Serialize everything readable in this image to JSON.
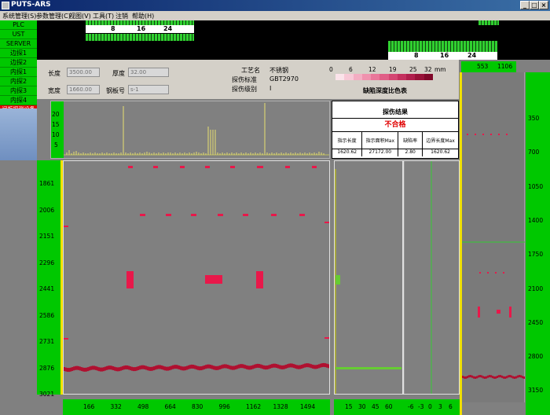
{
  "window": {
    "title": "PUTS-ARS",
    "btn_min": "_",
    "btn_max": "□",
    "btn_close": "×"
  },
  "menu": [
    "系统管理(S)",
    "参数管理(C)",
    "视图(V)",
    "工具(T)",
    "注销",
    "帮助(H)"
  ],
  "left_status": [
    "PLC",
    "UST",
    "SERVER",
    "边探1",
    "边探2",
    "内探1",
    "内探2",
    "内探3",
    "内探4"
  ],
  "left_alert": "闸板探测设备",
  "top_ruler_1": [
    "8",
    "16",
    "24"
  ],
  "top_ruler_2": [
    "8",
    "16",
    "24"
  ],
  "params": {
    "length_label": "长度",
    "length_value": "3500.00",
    "thickness_label": "厚度",
    "thickness_value": "32.00",
    "width_label": "宽度",
    "width_value": "1660.00",
    "plate_label": "钢板号",
    "plate_value": "s-1",
    "process_label": "工艺名",
    "process_value": "不锈钢",
    "standard_label": "探伤标准",
    "standard_value": "GBT2970",
    "level_label": "探伤级别",
    "level_value": "I"
  },
  "color_scale": {
    "ticks": [
      "0",
      "6",
      "12",
      "19",
      "25",
      "32",
      "mm"
    ],
    "caption": "缺陷深度比色表",
    "colors": [
      "#fbe3ea",
      "#f7c8d6",
      "#f3adc2",
      "#ef92ae",
      "#e9779a",
      "#e05e86",
      "#d44672",
      "#c4305e",
      "#b01e4c",
      "#981238",
      "#80082a"
    ]
  },
  "result": {
    "title": "探伤结果",
    "verdict": "不合格",
    "headers": [
      "指示长度",
      "指示面积Max",
      "缺陷率",
      "边界长度Max"
    ],
    "values": [
      "1620.62",
      "27172.00",
      "2.80",
      "1620.62"
    ]
  },
  "histogram": {
    "yticks": [
      "20",
      "15",
      "10",
      "5"
    ]
  },
  "main_y_ticks": [
    "1861",
    "2006",
    "2151",
    "2296",
    "2441",
    "2586",
    "2731",
    "2876",
    "3021"
  ],
  "main_x_ticks": [
    "166",
    "332",
    "498",
    "664",
    "830",
    "996",
    "1162",
    "1328",
    "1494"
  ],
  "side1_x_ticks": [
    "15",
    "30",
    "45",
    "60"
  ],
  "side2_x_ticks": [
    "-6",
    "-3",
    "0",
    "3",
    "6"
  ],
  "right_header": [
    "553",
    "1106"
  ],
  "right_y_ticks": [
    "350",
    "700",
    "1050",
    "1400",
    "1750",
    "2100",
    "2450",
    "2800",
    "3150"
  ],
  "colors": {
    "defect": "#e8184a",
    "defect_dark": "#b01030",
    "green": "#00c800",
    "yellow": "#f0e000"
  }
}
